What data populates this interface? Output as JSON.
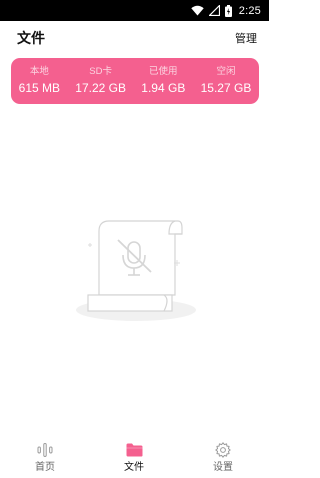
{
  "status_bar": {
    "time": "2:25",
    "icons": [
      "wifi-icon",
      "signal-icon",
      "battery-charging-icon"
    ]
  },
  "header": {
    "title": "文件",
    "manage_label": "管理"
  },
  "storage": {
    "items": [
      {
        "label": "本地",
        "value": "615 MB"
      },
      {
        "label": "SD卡",
        "value": "17.22 GB"
      },
      {
        "label": "已使用",
        "value": "1.94 GB"
      },
      {
        "label": "空闲",
        "value": "15.27 GB"
      }
    ]
  },
  "empty_state": {
    "icon": "muted-microphone-document-icon"
  },
  "bottom_nav": {
    "items": [
      {
        "label": "首页",
        "icon": "audio-bars-icon",
        "active": false
      },
      {
        "label": "文件",
        "icon": "folder-icon",
        "active": true
      },
      {
        "label": "设置",
        "icon": "gear-icon",
        "active": false
      }
    ]
  },
  "colors": {
    "accent": "#f4608f",
    "status_bar": "#000000",
    "nav_inactive": "#999999"
  }
}
